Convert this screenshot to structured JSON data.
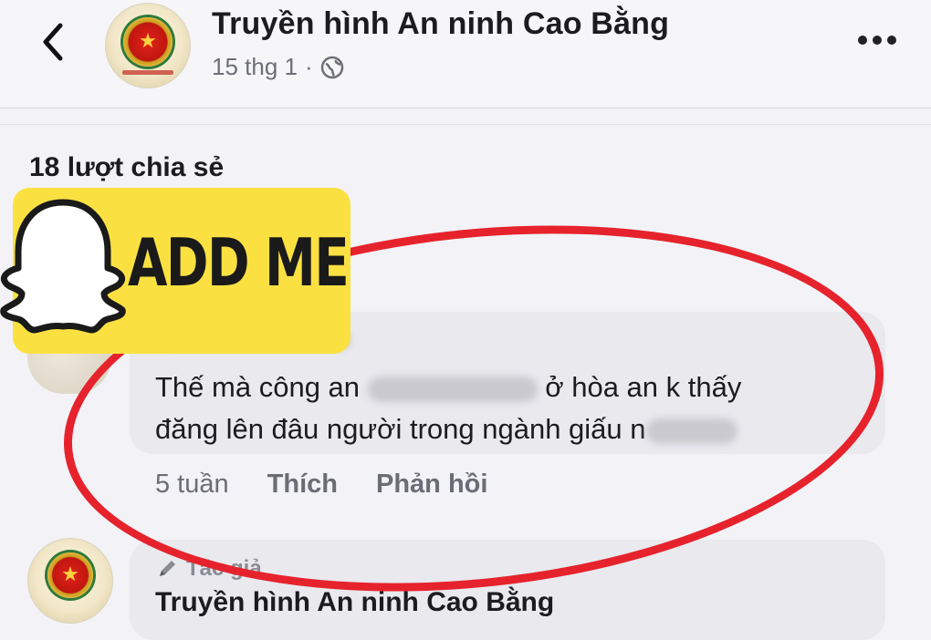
{
  "header": {
    "page_name": "Truyền hình An ninh Cao Bằng",
    "date": "15 thg 1",
    "separator": "·"
  },
  "post": {
    "share_count": "18 lượt chia sẻ"
  },
  "sticker": {
    "text": "ADD ME",
    "icon": "ghost-icon",
    "background": "#fae141"
  },
  "comment": {
    "line1_start": "Thế mà công an",
    "line1_end": "ở hòa an k thấy",
    "line2_start": "đăng lên đâu người trong ngành giấu n",
    "actions": {
      "time": "5 tuần",
      "like": "Thích",
      "reply": "Phản hồi"
    }
  },
  "reply": {
    "badge": "Tác giả",
    "name": "Truyền hình An ninh Cao Bằng"
  },
  "colors": {
    "annotation_ellipse": "#e6232c",
    "bubble": "#e9e9ee"
  }
}
